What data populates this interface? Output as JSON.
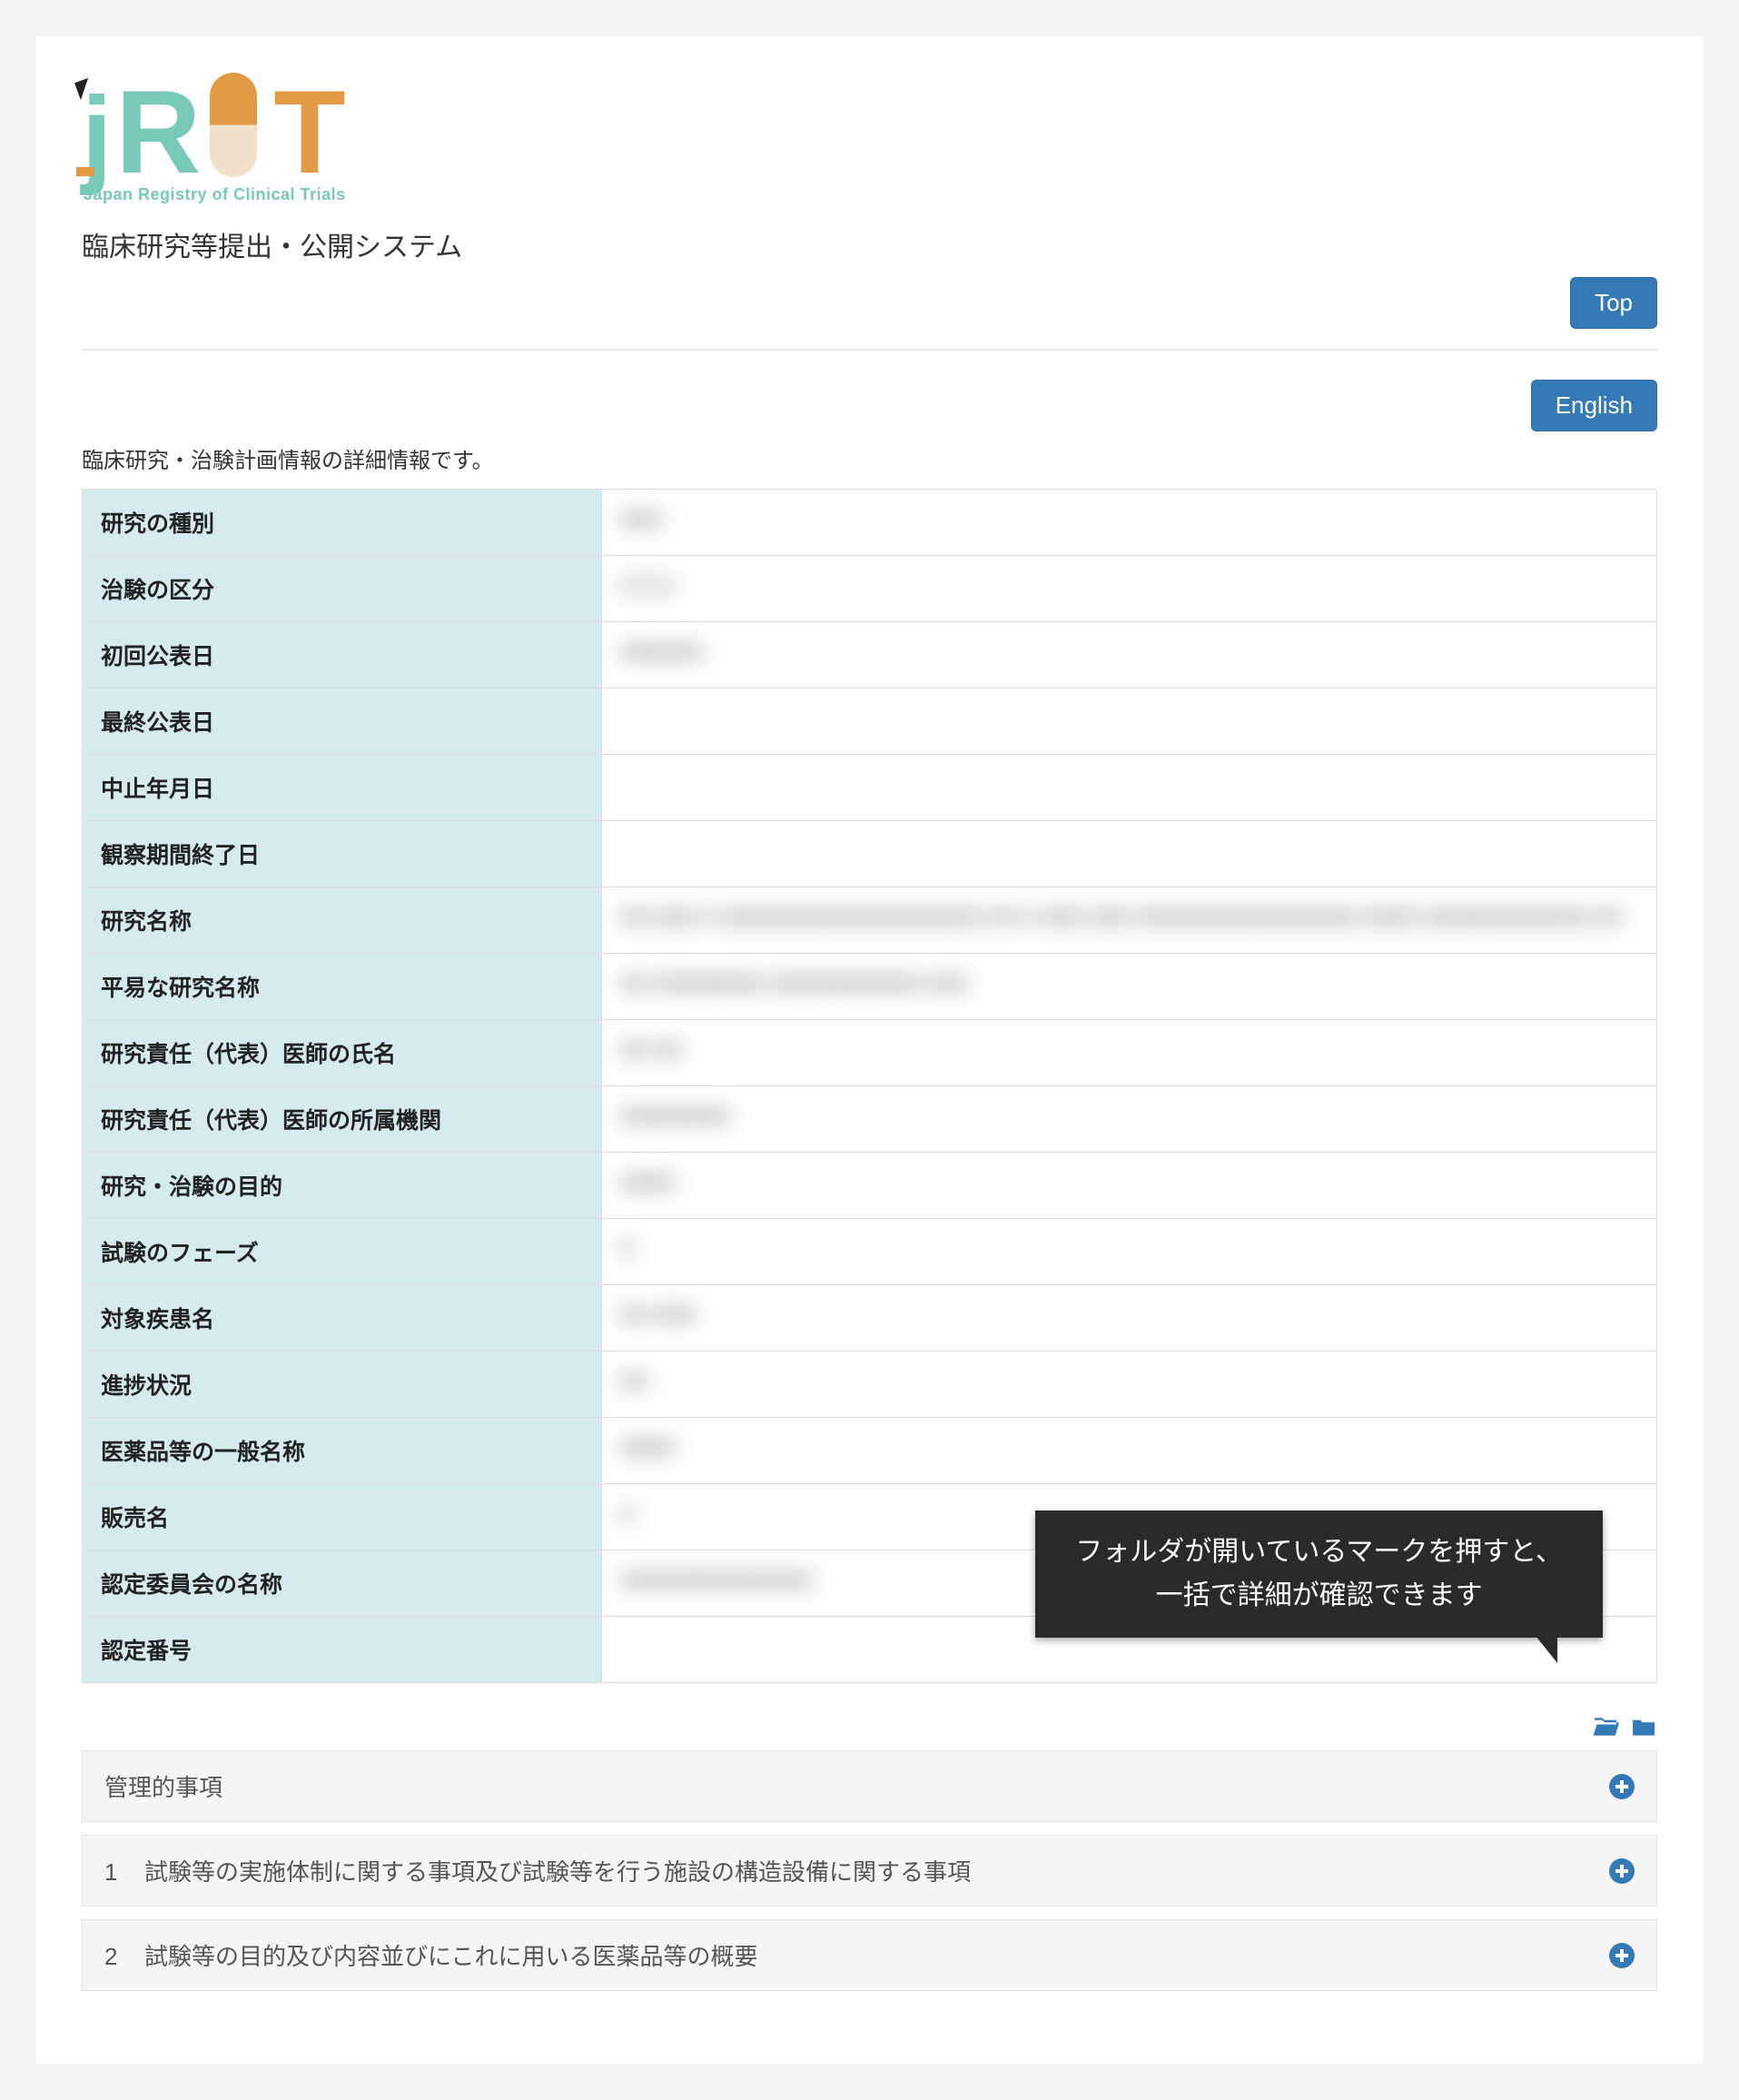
{
  "logo": {
    "subtitle": "Japan Registry of Clinical Trials"
  },
  "system_title": "臨床研究等提出・公開システム",
  "buttons": {
    "top": "Top",
    "english": "English"
  },
  "description": "臨床研究・治験計画情報の詳細情報です。",
  "summary_rows": [
    {
      "label": "研究の種別",
      "value": "■■■"
    },
    {
      "label": "治験の区分",
      "value": "■ ■ ■"
    },
    {
      "label": "初回公表日",
      "value": "■■■■■■"
    },
    {
      "label": "最終公表日",
      "value": ""
    },
    {
      "label": "中止年月日",
      "value": ""
    },
    {
      "label": "観察期間終了日",
      "value": ""
    },
    {
      "label": "研究名称",
      "value": "■■ ■■■ ■ ■■■■■■■■■■■■■■■■■■■ ■■ ■ ■■■ ■■■ ■■■■■■■■■■■■■■■■ ■■■■ ■■■■■■■■■■■■ ■■"
    },
    {
      "label": "平易な研究名称",
      "value": "■■ ■■■■■■■■ ■■■■■■■■■■■ ■■■"
    },
    {
      "label": "研究責任（代表）医師の氏名",
      "value": "■■ ■■"
    },
    {
      "label": "研究責任（代表）医師の所属機関",
      "value": "■■■■■■■■"
    },
    {
      "label": "研究・治験の目的",
      "value": "■■■■"
    },
    {
      "label": "試験のフェーズ",
      "value": "■"
    },
    {
      "label": "対象疾患名",
      "value": "■■ ■■■"
    },
    {
      "label": "進捗状況",
      "value": "■■"
    },
    {
      "label": "医薬品等の一般名称",
      "value": "■■■■"
    },
    {
      "label": "販売名",
      "value": "■"
    },
    {
      "label": "認定委員会の名称",
      "value": "■■■■■■■■■■■■■■"
    },
    {
      "label": "認定番号",
      "value": ""
    }
  ],
  "tooltip": {
    "line1": "フォルダが開いているマークを押すと、",
    "line2": "一括で詳細が確認できます"
  },
  "accordions": [
    {
      "num": "",
      "title": "管理的事項"
    },
    {
      "num": "1",
      "title": "試験等の実施体制に関する事項及び試験等を行う施設の構造設備に関する事項"
    },
    {
      "num": "2",
      "title": "試験等の目的及び内容並びにこれに用いる医薬品等の概要"
    }
  ]
}
